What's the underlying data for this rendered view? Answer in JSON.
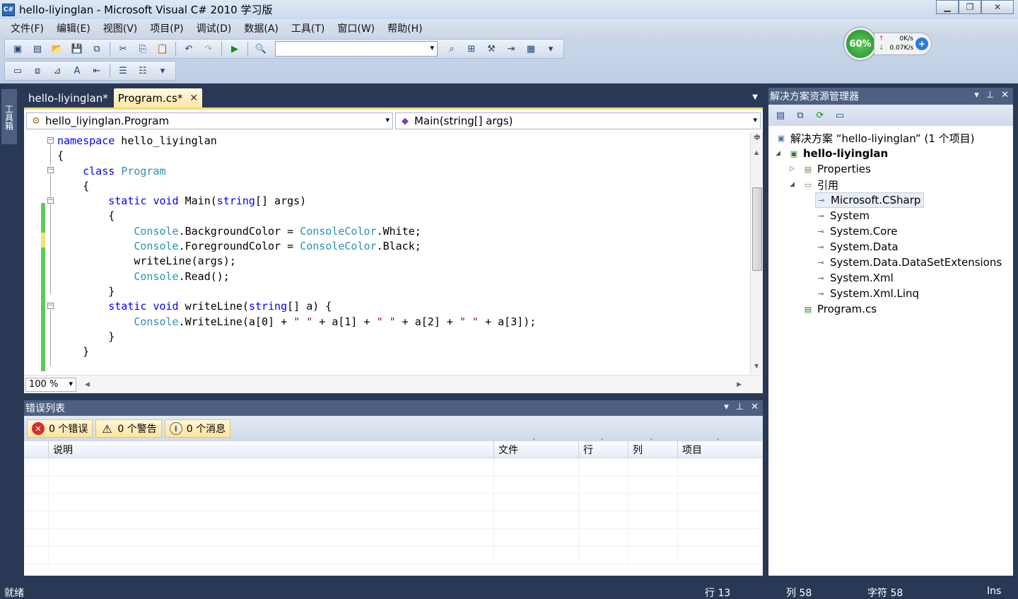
{
  "window": {
    "title": "hello-liyinglan - Microsoft Visual C# 2010 学习版",
    "app_icon_text": "C#",
    "controls": [
      "minimize-icon",
      "restore-icon",
      "close-icon"
    ]
  },
  "menu": [
    "文件(F)",
    "编辑(E)",
    "视图(V)",
    "项目(P)",
    "调试(D)",
    "数据(A)",
    "工具(T)",
    "窗口(W)",
    "帮助(H)"
  ],
  "net_widget": {
    "percent": "60%",
    "upload": "0K/s",
    "download": "0.07K/s"
  },
  "toolbox": {
    "label": "工具箱"
  },
  "editor": {
    "tabs": [
      {
        "label": "hello-liyinglan*",
        "active": false
      },
      {
        "label": "Program.cs*",
        "active": true
      }
    ],
    "type_combo": "hello_liyinglan.Program",
    "member_combo": "Main(string[] args)",
    "zoom": "100 %",
    "code_lines": [
      "namespace hello_liyinglan",
      "{",
      "    class Program",
      "    {",
      "        static void Main(string[] args)",
      "        {",
      "            Console.BackgroundColor = ConsoleColor.White;",
      "            Console.ForegroundColor = ConsoleColor.Black;",
      "            writeLine(args);",
      "            Console.Read();",
      "        }",
      "        static void writeLine(string[] a) {",
      "            Console.WriteLine(a[0] + \" \" + a[1] + \" \" + a[2] + \" \" + a[3]);",
      "        }",
      "    }"
    ]
  },
  "error_list": {
    "title": "错误列表",
    "errors_label": "0 个错误",
    "warnings_label": "0 个警告",
    "messages_label": "0 个消息",
    "columns": [
      "说明",
      "文件",
      "行",
      "列",
      "项目"
    ]
  },
  "solution_explorer": {
    "title": "解决方案资源管理器",
    "solution": "解决方案 “hello-liyinglan” (1 个项目)",
    "project": "hello-liyinglan",
    "properties": "Properties",
    "references_folder": "引用",
    "references": [
      "Microsoft.CSharp",
      "System",
      "System.Core",
      "System.Data",
      "System.Data.DataSetExtensions",
      "System.Xml",
      "System.Xml.Linq"
    ],
    "file": "Program.cs"
  },
  "status": {
    "ready": "就绪",
    "line": "行 13",
    "col": "列 58",
    "char": "字符 58",
    "mode": "Ins"
  }
}
